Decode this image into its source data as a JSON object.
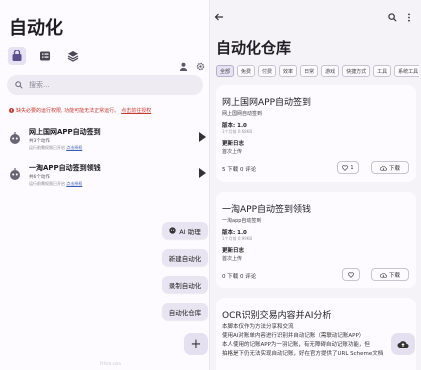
{
  "left": {
    "title": "自动化",
    "tabs": [
      {
        "icon": "home-icon",
        "active": true
      },
      {
        "icon": "list-icon",
        "active": false
      },
      {
        "icon": "layers-icon",
        "active": false
      }
    ],
    "top_icons": [
      "person-icon",
      "gear-icon"
    ],
    "search_placeholder": "搜索...",
    "warning": {
      "text": "缺失必要的运行权限, 功能可能无法正常运行。",
      "link": "点击前往授权"
    },
    "tasks": [
      {
        "title": "网上国网APP自动签到",
        "subtitle": "共3个动作",
        "status": "运行前需权限已开启 ",
        "link": "点击授权"
      },
      {
        "title": "一淘APP自动签到领钱",
        "subtitle": "共6个动作",
        "status": "运行前需权限已开启 ",
        "link": "点击授权"
      }
    ],
    "fab_menu": [
      {
        "label": "AI 助理",
        "icon": "ai-icon"
      },
      {
        "label": "新建自动化"
      },
      {
        "label": "录制自动化"
      },
      {
        "label": "自动化仓库"
      }
    ],
    "fab_plus": "+",
    "watermark": "Ftfsm.com"
  },
  "right": {
    "title": "自动化仓库",
    "chips": [
      "全部",
      "免费",
      "付费",
      "效率",
      "日常",
      "游戏",
      "快捷方式",
      "工具",
      "系统工具"
    ],
    "active_chip": "全部",
    "cards": [
      {
        "title": "网上国网APP自动签到",
        "desc": "网上国网自动签到",
        "version_label": "版本: 1.0",
        "version_meta": "1个月前    0.68KB",
        "changelog_label": "更新日志",
        "changelog": "首次上传",
        "stats": "5 下载   0 评论",
        "likes": "1",
        "download_label": "下载"
      },
      {
        "title": "一淘APP自动签到领钱",
        "desc": "一淘app自动签到",
        "version_label": "版本: 1.0",
        "version_meta": "1个月前    0.99KB",
        "changelog_label": "更新日志",
        "changelog": "首次上传",
        "stats": "0 下载   0 评论",
        "likes": "",
        "download_label": "下载"
      },
      {
        "title": "OCR识别交易内容并AI分析",
        "lines": [
          "本脚本仅作为方法分享和交流",
          "使用AI对账单内容进行识别并自动记账（需联动记账APP）",
          "本人使用的记账APP为一羽记账，有无障碍自动记账功能，但",
          "拍格是下仍无法实现自动记账，好在官方提供了URL Scheme文档"
        ]
      }
    ]
  }
}
